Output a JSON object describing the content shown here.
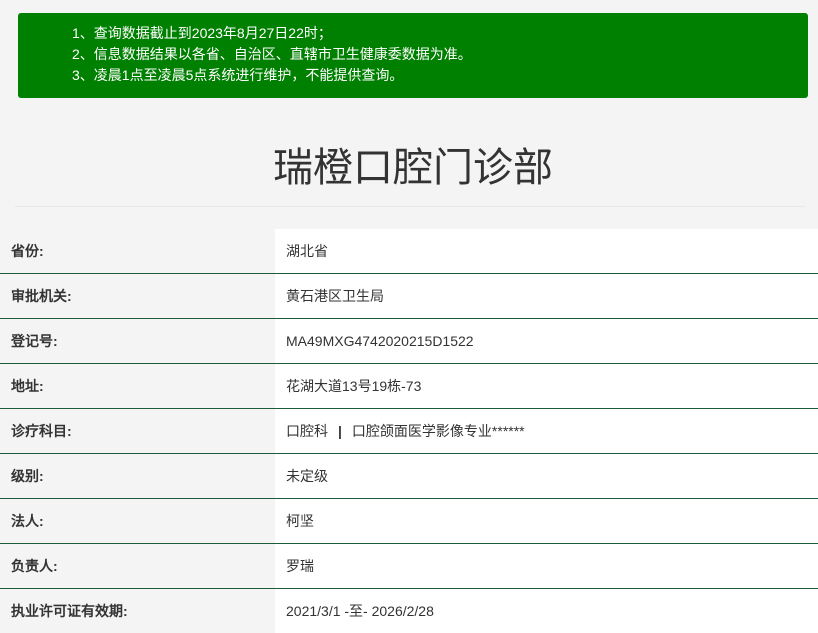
{
  "notice": {
    "lines": [
      "1、查询数据截止到2023年8月27日22时；",
      "2、信息数据结果以各省、自治区、直辖市卫生健康委数据为准。",
      "3、凌晨1点至凌晨5点系统进行维护，不能提供查询。"
    ],
    "background_color": "#008000"
  },
  "title": "瑞橙口腔门诊部",
  "info": {
    "rows": [
      {
        "label": "省份:",
        "value": "湖北省"
      },
      {
        "label": "审批机关:",
        "value": "黄石港区卫生局"
      },
      {
        "label": "登记号:",
        "value": "MA49MXG4742020215D1522"
      },
      {
        "label": "地址:",
        "value": "花湖大道13号19栋-73"
      },
      {
        "label": "诊疗科目:",
        "value_parts": [
          "口腔科",
          "|",
          "口腔颌面医学影像专业******"
        ]
      },
      {
        "label": "级别:",
        "value": "未定级"
      },
      {
        "label": "法人:",
        "value": "柯坚"
      },
      {
        "label": "负责人:",
        "value": "罗瑞"
      },
      {
        "label": "执业许可证有效期:",
        "value": "2021/3/1 -至- 2026/2/28"
      }
    ]
  }
}
